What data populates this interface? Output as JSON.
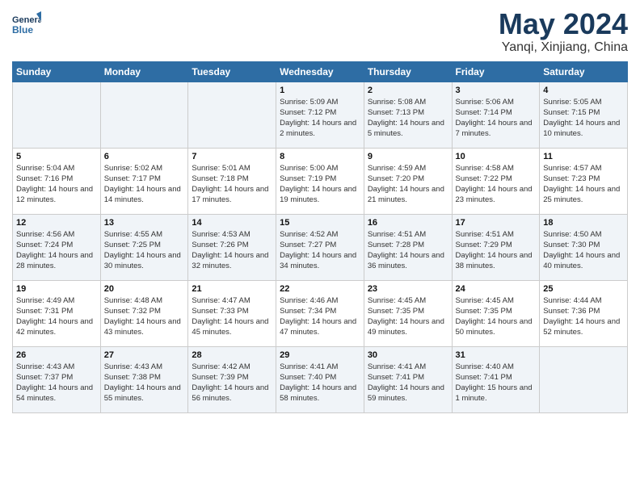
{
  "header": {
    "logo_line1": "General",
    "logo_line2": "Blue",
    "title": "May 2024",
    "location": "Yanqi, Xinjiang, China"
  },
  "weekdays": [
    "Sunday",
    "Monday",
    "Tuesday",
    "Wednesday",
    "Thursday",
    "Friday",
    "Saturday"
  ],
  "weeks": [
    [
      {
        "day": "",
        "sunrise": "",
        "sunset": "",
        "daylight": ""
      },
      {
        "day": "",
        "sunrise": "",
        "sunset": "",
        "daylight": ""
      },
      {
        "day": "",
        "sunrise": "",
        "sunset": "",
        "daylight": ""
      },
      {
        "day": "1",
        "sunrise": "Sunrise: 5:09 AM",
        "sunset": "Sunset: 7:12 PM",
        "daylight": "Daylight: 14 hours and 2 minutes."
      },
      {
        "day": "2",
        "sunrise": "Sunrise: 5:08 AM",
        "sunset": "Sunset: 7:13 PM",
        "daylight": "Daylight: 14 hours and 5 minutes."
      },
      {
        "day": "3",
        "sunrise": "Sunrise: 5:06 AM",
        "sunset": "Sunset: 7:14 PM",
        "daylight": "Daylight: 14 hours and 7 minutes."
      },
      {
        "day": "4",
        "sunrise": "Sunrise: 5:05 AM",
        "sunset": "Sunset: 7:15 PM",
        "daylight": "Daylight: 14 hours and 10 minutes."
      }
    ],
    [
      {
        "day": "5",
        "sunrise": "Sunrise: 5:04 AM",
        "sunset": "Sunset: 7:16 PM",
        "daylight": "Daylight: 14 hours and 12 minutes."
      },
      {
        "day": "6",
        "sunrise": "Sunrise: 5:02 AM",
        "sunset": "Sunset: 7:17 PM",
        "daylight": "Daylight: 14 hours and 14 minutes."
      },
      {
        "day": "7",
        "sunrise": "Sunrise: 5:01 AM",
        "sunset": "Sunset: 7:18 PM",
        "daylight": "Daylight: 14 hours and 17 minutes."
      },
      {
        "day": "8",
        "sunrise": "Sunrise: 5:00 AM",
        "sunset": "Sunset: 7:19 PM",
        "daylight": "Daylight: 14 hours and 19 minutes."
      },
      {
        "day": "9",
        "sunrise": "Sunrise: 4:59 AM",
        "sunset": "Sunset: 7:20 PM",
        "daylight": "Daylight: 14 hours and 21 minutes."
      },
      {
        "day": "10",
        "sunrise": "Sunrise: 4:58 AM",
        "sunset": "Sunset: 7:22 PM",
        "daylight": "Daylight: 14 hours and 23 minutes."
      },
      {
        "day": "11",
        "sunrise": "Sunrise: 4:57 AM",
        "sunset": "Sunset: 7:23 PM",
        "daylight": "Daylight: 14 hours and 25 minutes."
      }
    ],
    [
      {
        "day": "12",
        "sunrise": "Sunrise: 4:56 AM",
        "sunset": "Sunset: 7:24 PM",
        "daylight": "Daylight: 14 hours and 28 minutes."
      },
      {
        "day": "13",
        "sunrise": "Sunrise: 4:55 AM",
        "sunset": "Sunset: 7:25 PM",
        "daylight": "Daylight: 14 hours and 30 minutes."
      },
      {
        "day": "14",
        "sunrise": "Sunrise: 4:53 AM",
        "sunset": "Sunset: 7:26 PM",
        "daylight": "Daylight: 14 hours and 32 minutes."
      },
      {
        "day": "15",
        "sunrise": "Sunrise: 4:52 AM",
        "sunset": "Sunset: 7:27 PM",
        "daylight": "Daylight: 14 hours and 34 minutes."
      },
      {
        "day": "16",
        "sunrise": "Sunrise: 4:51 AM",
        "sunset": "Sunset: 7:28 PM",
        "daylight": "Daylight: 14 hours and 36 minutes."
      },
      {
        "day": "17",
        "sunrise": "Sunrise: 4:51 AM",
        "sunset": "Sunset: 7:29 PM",
        "daylight": "Daylight: 14 hours and 38 minutes."
      },
      {
        "day": "18",
        "sunrise": "Sunrise: 4:50 AM",
        "sunset": "Sunset: 7:30 PM",
        "daylight": "Daylight: 14 hours and 40 minutes."
      }
    ],
    [
      {
        "day": "19",
        "sunrise": "Sunrise: 4:49 AM",
        "sunset": "Sunset: 7:31 PM",
        "daylight": "Daylight: 14 hours and 42 minutes."
      },
      {
        "day": "20",
        "sunrise": "Sunrise: 4:48 AM",
        "sunset": "Sunset: 7:32 PM",
        "daylight": "Daylight: 14 hours and 43 minutes."
      },
      {
        "day": "21",
        "sunrise": "Sunrise: 4:47 AM",
        "sunset": "Sunset: 7:33 PM",
        "daylight": "Daylight: 14 hours and 45 minutes."
      },
      {
        "day": "22",
        "sunrise": "Sunrise: 4:46 AM",
        "sunset": "Sunset: 7:34 PM",
        "daylight": "Daylight: 14 hours and 47 minutes."
      },
      {
        "day": "23",
        "sunrise": "Sunrise: 4:45 AM",
        "sunset": "Sunset: 7:35 PM",
        "daylight": "Daylight: 14 hours and 49 minutes."
      },
      {
        "day": "24",
        "sunrise": "Sunrise: 4:45 AM",
        "sunset": "Sunset: 7:35 PM",
        "daylight": "Daylight: 14 hours and 50 minutes."
      },
      {
        "day": "25",
        "sunrise": "Sunrise: 4:44 AM",
        "sunset": "Sunset: 7:36 PM",
        "daylight": "Daylight: 14 hours and 52 minutes."
      }
    ],
    [
      {
        "day": "26",
        "sunrise": "Sunrise: 4:43 AM",
        "sunset": "Sunset: 7:37 PM",
        "daylight": "Daylight: 14 hours and 54 minutes."
      },
      {
        "day": "27",
        "sunrise": "Sunrise: 4:43 AM",
        "sunset": "Sunset: 7:38 PM",
        "daylight": "Daylight: 14 hours and 55 minutes."
      },
      {
        "day": "28",
        "sunrise": "Sunrise: 4:42 AM",
        "sunset": "Sunset: 7:39 PM",
        "daylight": "Daylight: 14 hours and 56 minutes."
      },
      {
        "day": "29",
        "sunrise": "Sunrise: 4:41 AM",
        "sunset": "Sunset: 7:40 PM",
        "daylight": "Daylight: 14 hours and 58 minutes."
      },
      {
        "day": "30",
        "sunrise": "Sunrise: 4:41 AM",
        "sunset": "Sunset: 7:41 PM",
        "daylight": "Daylight: 14 hours and 59 minutes."
      },
      {
        "day": "31",
        "sunrise": "Sunrise: 4:40 AM",
        "sunset": "Sunset: 7:41 PM",
        "daylight": "Daylight: 15 hours and 1 minute."
      },
      {
        "day": "",
        "sunrise": "",
        "sunset": "",
        "daylight": ""
      }
    ]
  ]
}
